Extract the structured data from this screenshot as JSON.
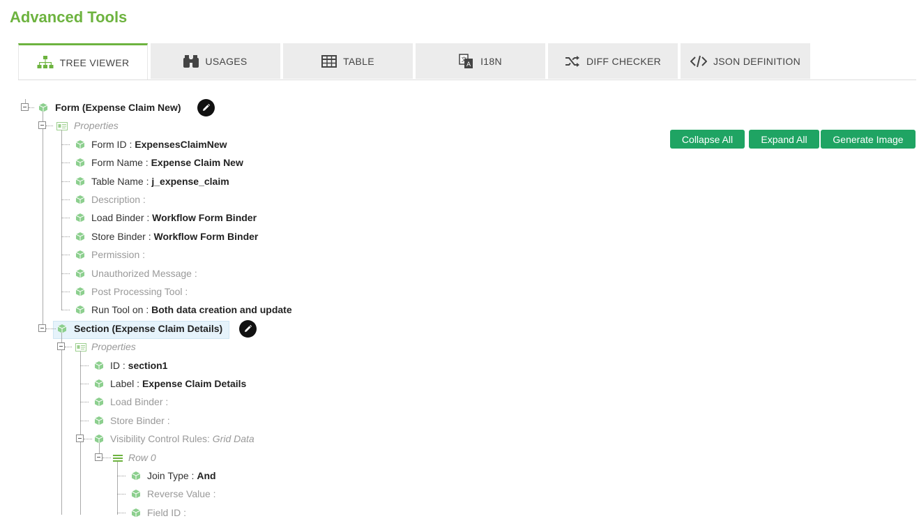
{
  "page": {
    "title": "Advanced Tools"
  },
  "tabs": [
    {
      "label": "TREE VIEWER",
      "icon": "sitemap-icon",
      "active": true
    },
    {
      "label": "USAGES",
      "icon": "binoculars-icon"
    },
    {
      "label": "TABLE",
      "icon": "table-icon"
    },
    {
      "label": "I18N",
      "icon": "language-icon"
    },
    {
      "label": "DIFF CHECKER",
      "icon": "shuffle-icon"
    },
    {
      "label": "JSON DEFINITION",
      "icon": "code-icon"
    }
  ],
  "actions": {
    "collapse_all": "Collapse All",
    "expand_all": "Expand All",
    "generate_image": "Generate Image"
  },
  "tree": {
    "form": {
      "label": "Form (Expense Claim New)"
    },
    "form_props": {
      "label": "Properties",
      "items": [
        {
          "key": "Form ID : ",
          "value": "ExpensesClaimNew"
        },
        {
          "key": "Form Name : ",
          "value": "Expense Claim New"
        },
        {
          "key": "Table Name : ",
          "value": "j_expense_claim"
        },
        {
          "key": "Description :",
          "value": ""
        },
        {
          "key": "Load Binder : ",
          "value": "Workflow Form Binder"
        },
        {
          "key": "Store Binder : ",
          "value": "Workflow Form Binder"
        },
        {
          "key": "Permission :",
          "value": ""
        },
        {
          "key": "Unauthorized Message :",
          "value": ""
        },
        {
          "key": "Post Processing Tool :",
          "value": ""
        },
        {
          "key": "Run Tool on : ",
          "value": "Both data creation and update"
        }
      ]
    },
    "section": {
      "label": "Section (Expense Claim Details)"
    },
    "section_props": {
      "label": "Properties",
      "items": [
        {
          "key": "ID : ",
          "value": "section1"
        },
        {
          "key": "Label : ",
          "value": "Expense Claim Details"
        },
        {
          "key": "Load Binder :",
          "value": ""
        },
        {
          "key": "Store Binder :",
          "value": ""
        }
      ]
    },
    "visibility": {
      "key": "Visibility Control Rules: ",
      "value": "Grid Data"
    },
    "row0": {
      "label": "Row 0"
    },
    "row0_items": [
      {
        "key": "Join Type : ",
        "value": "And"
      },
      {
        "key": "Reverse Value :",
        "value": ""
      },
      {
        "key": "Field ID :",
        "value": ""
      }
    ]
  },
  "colors": {
    "brand_green": "#6db33f",
    "button_green": "#1fa463",
    "selected_bg": "#e6f3fb"
  }
}
